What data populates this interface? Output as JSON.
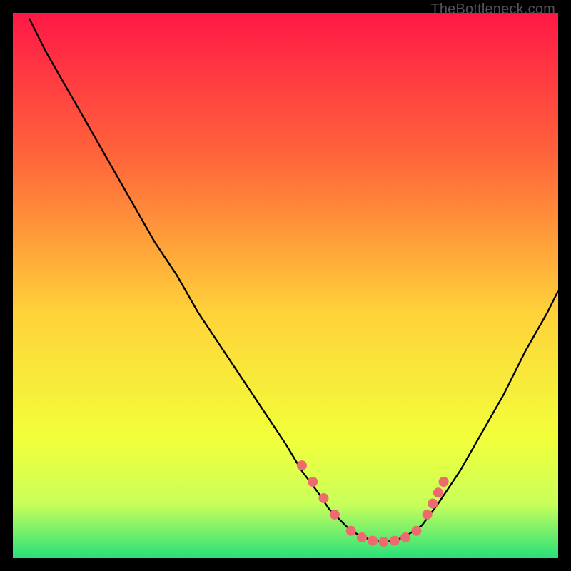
{
  "watermark": "TheBottleneck.com",
  "colors": {
    "bg": "#000000",
    "grad_top": "#ff1846",
    "grad_mid1": "#ff6a3a",
    "grad_mid2": "#ffd23a",
    "grad_mid3": "#f2ff3a",
    "grad_low": "#c9ff5a",
    "grad_bottom": "#28e07a",
    "curve": "#000000",
    "marker": "#ed6a6f"
  },
  "chart_data": {
    "type": "line",
    "title": "",
    "xlabel": "",
    "ylabel": "",
    "xlim": [
      0,
      100
    ],
    "ylim": [
      0,
      100
    ],
    "curve": {
      "name": "bottleneck-curve",
      "x": [
        3,
        6,
        10,
        14,
        18,
        22,
        26,
        30,
        34,
        38,
        42,
        46,
        50,
        53,
        56,
        58,
        60,
        62,
        64,
        66,
        68,
        70,
        72,
        75,
        78,
        82,
        86,
        90,
        94,
        98,
        100
      ],
      "y": [
        99,
        93,
        86,
        79,
        72,
        65,
        58,
        52,
        45,
        39,
        33,
        27,
        21,
        16,
        12,
        9,
        7,
        5,
        4,
        3.2,
        3,
        3.2,
        4,
        6,
        10,
        16,
        23,
        30,
        38,
        45,
        49
      ]
    },
    "markers": {
      "name": "highlight-points",
      "x": [
        53,
        55,
        57,
        59,
        62,
        64,
        66,
        68,
        70,
        72,
        74,
        76,
        77,
        78,
        79
      ],
      "y": [
        17,
        14,
        11,
        8,
        5,
        3.8,
        3.2,
        3,
        3.2,
        3.8,
        5,
        8,
        10,
        12,
        14
      ]
    }
  }
}
